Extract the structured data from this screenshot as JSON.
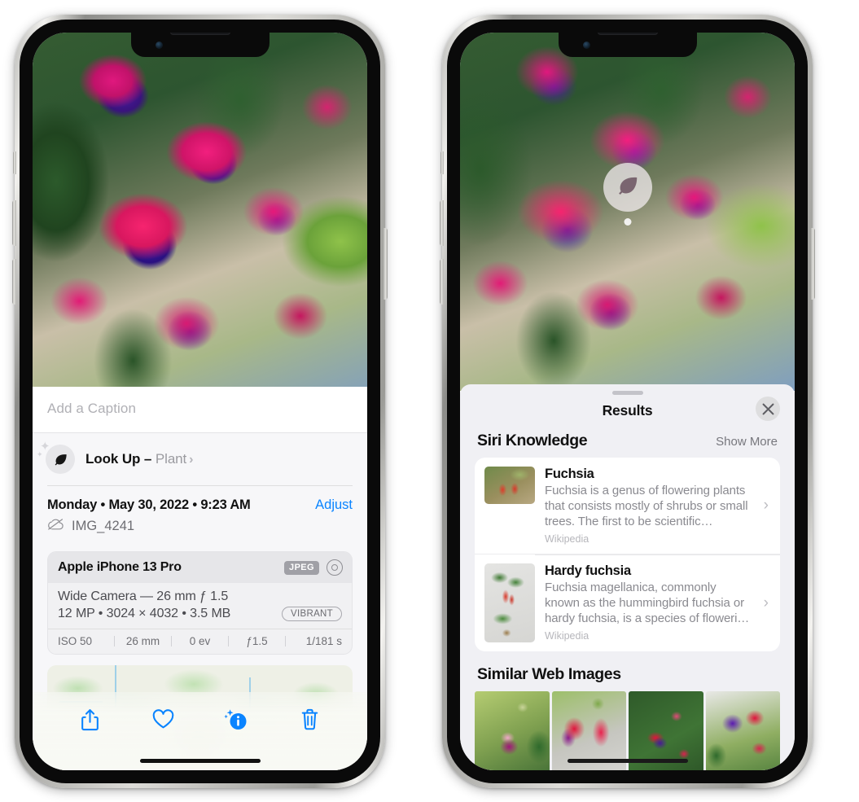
{
  "left_phone": {
    "photo": {
      "alt_name": "fuchsia-flowers-photo"
    },
    "caption": {
      "placeholder": "Add a Caption",
      "value": ""
    },
    "look_up": {
      "icon": "leaf-icon",
      "label": "Look Up",
      "dash": " – ",
      "subject": "Plant",
      "chevron": "›"
    },
    "capture_info": {
      "datetime": "Monday • May 30, 2022 • 9:23 AM",
      "adjust_label": "Adjust",
      "cloud_icon": "icloud-slash-icon",
      "filename": "IMG_4241"
    },
    "exif": {
      "device": "Apple iPhone 13 Pro",
      "format_badge": "JPEG",
      "raw_icon": "raw-circle-icon",
      "lens_line": "Wide Camera — 26 mm ƒ 1.5",
      "size_line": "12 MP • 3024 × 4032 • 3.5 MB",
      "style_badge": "VIBRANT",
      "stats": [
        "ISO 50",
        "26 mm",
        "0 ev",
        "ƒ1.5",
        "1/181 s"
      ]
    },
    "map": {
      "pin_name": "photo-location-pin"
    },
    "toolbar": [
      {
        "name": "share-button",
        "icon": "share-icon"
      },
      {
        "name": "favorite-button",
        "icon": "heart-icon"
      },
      {
        "name": "info-button",
        "icon": "info-sparkle-icon"
      },
      {
        "name": "delete-button",
        "icon": "trash-icon"
      }
    ]
  },
  "right_phone": {
    "vlu_badge": {
      "icon": "leaf-icon",
      "name": "visual-look-up-badge"
    },
    "sheet": {
      "title": "Results",
      "close_icon": "close-icon",
      "sections": [
        {
          "title": "Siri Knowledge",
          "action": "Show More",
          "items": [
            {
              "title": "Fuchsia",
              "description": "Fuchsia is a genus of flowering plants that consists mostly of shrubs or small trees. The first to be scientific…",
              "source": "Wikipedia",
              "chevron": "›"
            },
            {
              "title": "Hardy fuchsia",
              "description": "Fuchsia magellanica, commonly known as the hummingbird fuchsia or hardy fuchsia, is a species of floweri…",
              "source": "Wikipedia",
              "chevron": "›"
            }
          ]
        },
        {
          "title": "Similar Web Images",
          "thumbnails": [
            {
              "name": "web-image-1"
            },
            {
              "name": "web-image-2"
            },
            {
              "name": "web-image-3"
            },
            {
              "name": "web-image-4"
            }
          ]
        }
      ]
    }
  },
  "colors": {
    "accent_blue": "#0a84ff",
    "sheet_bg": "#f0f0f4",
    "card_bg": "#ffffff",
    "secondary_text": "#8a8a90"
  }
}
